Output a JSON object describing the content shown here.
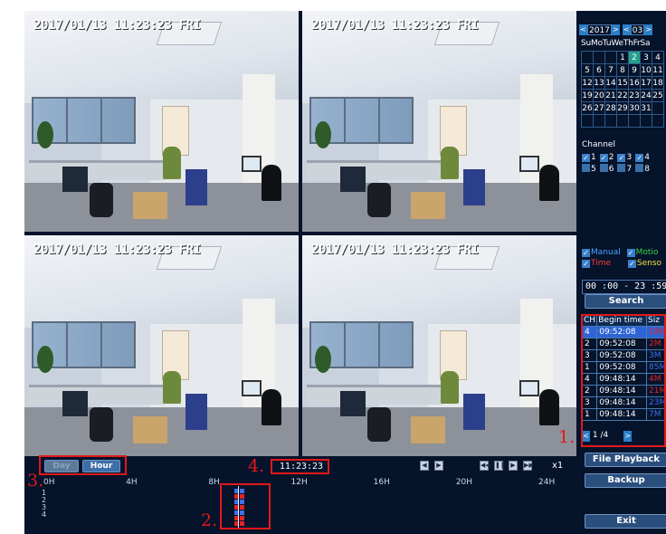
{
  "tiles": [
    {
      "timestamp": "2017/01/13 11:23:23 FRI"
    },
    {
      "timestamp": "2017/01/13 11:23:23 FRI"
    },
    {
      "timestamp": "2017/01/13 11:23:23 FRI"
    },
    {
      "timestamp": "2017/01/13 11:23:23 FRI"
    }
  ],
  "calendar": {
    "year": "2017",
    "month": "03",
    "weekdays": "SuMoTuWeThFrSa",
    "rows": [
      [
        "",
        "",
        "",
        "1",
        "2",
        "3",
        "4"
      ],
      [
        "5",
        "6",
        "7",
        "8",
        "9",
        "10",
        "11"
      ],
      [
        "12",
        "13",
        "14",
        "15",
        "16",
        "17",
        "18"
      ],
      [
        "19",
        "20",
        "21",
        "22",
        "23",
        "24",
        "25"
      ],
      [
        "26",
        "27",
        "28",
        "29",
        "30",
        "31",
        ""
      ],
      [
        "",
        "",
        "",
        "",
        "",
        "",
        ""
      ]
    ],
    "selected_day": "2"
  },
  "channel": {
    "label": "Channel",
    "row1": [
      "1",
      "2",
      "3",
      "4"
    ],
    "row2": [
      "5",
      "6",
      "7",
      "8"
    ],
    "checked": [
      "1",
      "2",
      "3",
      "4"
    ]
  },
  "record_types": {
    "manual": "Manual",
    "motion": "Motio",
    "time": "Time",
    "sensor": "Senso"
  },
  "time_range": "00 :00 - 23 :59",
  "search_label": "Search",
  "results": {
    "headers": {
      "ch": "CH",
      "begin": "Begin time",
      "size": "Siz"
    },
    "rows": [
      {
        "ch": "4",
        "begin": "09:52:08",
        "size": "18M"
      },
      {
        "ch": "2",
        "begin": "09:52:08",
        "size": "2M"
      },
      {
        "ch": "3",
        "begin": "09:52:08",
        "size": "3M"
      },
      {
        "ch": "1",
        "begin": "09:52:08",
        "size": "85M"
      },
      {
        "ch": "4",
        "begin": "09:48:14",
        "size": "4M"
      },
      {
        "ch": "2",
        "begin": "09:48:14",
        "size": "21M"
      },
      {
        "ch": "3",
        "begin": "09:48:14",
        "size": "23M"
      },
      {
        "ch": "1",
        "begin": "09:48:14",
        "size": "7M"
      }
    ],
    "page_current": "1",
    "page_total": "/4"
  },
  "buttons": {
    "file_playback": "File Playback",
    "backup": "Backup",
    "exit": "Exit",
    "day": "Day",
    "hour": "Hour"
  },
  "timeline": {
    "current_time": "11:23:23",
    "speed": "x1",
    "ticks": [
      "0H",
      "4H",
      "8H",
      "12H",
      "16H",
      "20H",
      "24H"
    ],
    "rows": [
      "1",
      "2",
      "3",
      "4"
    ]
  },
  "annotations": [
    "1.",
    "2.",
    "3.",
    "4."
  ],
  "colors": {
    "background": "#05132b",
    "annotation_red": "#e31818",
    "record_red": "#e02424",
    "record_blue": "#3f6fe8",
    "selected_day": "#26a08b",
    "highlight_row": "#2e64d6"
  }
}
